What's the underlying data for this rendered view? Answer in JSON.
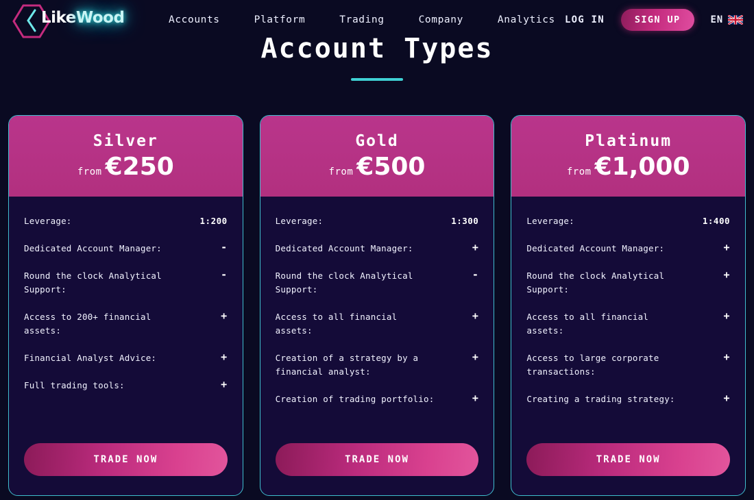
{
  "brand": {
    "name_part1": "Like",
    "name_part2": "Wood",
    "hex_color": "#c42b7e",
    "chevron_color": "#3fd0d4"
  },
  "nav": {
    "items": [
      {
        "label": "Accounts"
      },
      {
        "label": "Platform"
      },
      {
        "label": "Trading"
      },
      {
        "label": "Company"
      },
      {
        "label": "Analytics"
      }
    ]
  },
  "auth": {
    "login_label": "LOG IN",
    "signup_label": "SIGN UP",
    "language_code": "EN",
    "language_flag": "uk-flag-icon"
  },
  "page": {
    "title": "Account Types",
    "accent_color": "#3fd0d4"
  },
  "cards": [
    {
      "name": "Silver",
      "from_label": "from",
      "price": "€250",
      "cta_label": "TRADE NOW",
      "features": [
        {
          "label": "Leverage:",
          "value": "1:200",
          "type": "text"
        },
        {
          "label": "Dedicated Account Manager:",
          "value": "-",
          "type": "mark"
        },
        {
          "label": "Round the clock Analytical Support:",
          "value": "-",
          "type": "mark"
        },
        {
          "label": "Access to 200+ financial assets:",
          "value": "+",
          "type": "mark"
        },
        {
          "label": "Financial Analyst Advice:",
          "value": "+",
          "type": "mark"
        },
        {
          "label": "Full trading tools:",
          "value": "+",
          "type": "mark"
        }
      ]
    },
    {
      "name": "Gold",
      "from_label": "from",
      "price": "€500",
      "cta_label": "TRADE NOW",
      "features": [
        {
          "label": "Leverage:",
          "value": "1:300",
          "type": "text"
        },
        {
          "label": "Dedicated Account Manager:",
          "value": "+",
          "type": "mark"
        },
        {
          "label": "Round the clock Analytical Support:",
          "value": "-",
          "type": "mark"
        },
        {
          "label": "Access to all financial assets:",
          "value": "+",
          "type": "mark"
        },
        {
          "label": "Creation of a strategy by a financial analyst:",
          "value": "+",
          "type": "mark"
        },
        {
          "label": "Creation of trading portfolio:",
          "value": "+",
          "type": "mark"
        }
      ]
    },
    {
      "name": "Platinum",
      "from_label": "from",
      "price": "€1,000",
      "cta_label": "TRADE NOW",
      "features": [
        {
          "label": "Leverage:",
          "value": "1:400",
          "type": "text"
        },
        {
          "label": "Dedicated Account Manager:",
          "value": "+",
          "type": "mark"
        },
        {
          "label": "Round the clock Analytical Support:",
          "value": "+",
          "type": "mark"
        },
        {
          "label": "Access to all financial assets:",
          "value": "+",
          "type": "mark"
        },
        {
          "label": "Access to large corporate transactions:",
          "value": "+",
          "type": "mark"
        },
        {
          "label": "Creating a trading strategy:",
          "value": "+",
          "type": "mark"
        }
      ]
    }
  ]
}
